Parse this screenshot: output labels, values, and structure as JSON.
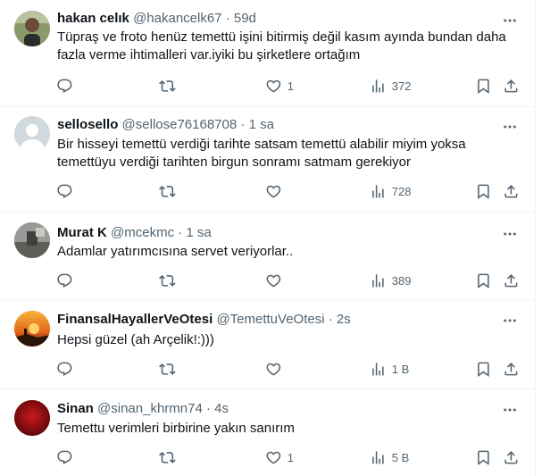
{
  "tweets": [
    {
      "name": "hakan celık",
      "handle": "@hakancelk67",
      "sep": "·",
      "time": "59d",
      "text": "Tüpraş ve froto henüz temettü işini bitirmiş değil kasım ayında bundan daha fazla verme ihtimalleri var.iyiki bu şirketlere ortağım",
      "likes": "1",
      "views": "372"
    },
    {
      "name": "sellosello",
      "handle": "@sellose76168708",
      "sep": "·",
      "time": "1 sa",
      "text": "Bir hisseyi temettü verdiği tarihte satsam temettü alabilir miyim yoksa temettüyu verdiği tarihten birgun sonramı satmam gerekiyor",
      "likes": "",
      "views": "728"
    },
    {
      "name": "Murat K",
      "handle": "@mcekmc",
      "sep": "·",
      "time": "1 sa",
      "text": "Adamlar yatırımcısına servet veriyorlar..",
      "likes": "",
      "views": "389"
    },
    {
      "name": "FinansalHayallerVeOtesi",
      "handle": "@TemettuVeOtesi",
      "sep": "·",
      "time": "2s",
      "text": "Hepsi güzel (ah Arçelik!:)))",
      "likes": "",
      "views": "1 B"
    },
    {
      "name": "Sinan",
      "handle": "@sinan_khrmn74",
      "sep": "·",
      "time": "4s",
      "text": "Temettu verimleri birbirine yakın sanırım",
      "likes": "1",
      "views": "5 B"
    }
  ],
  "icons": {
    "more": "more-icon",
    "reply": "reply-icon",
    "retweet": "retweet-icon",
    "like": "heart-icon",
    "views": "views-icon",
    "bookmark": "bookmark-icon",
    "share": "share-icon"
  },
  "colors": {
    "text": "#0f1419",
    "muted": "#536471",
    "divider": "#eff3f4"
  }
}
